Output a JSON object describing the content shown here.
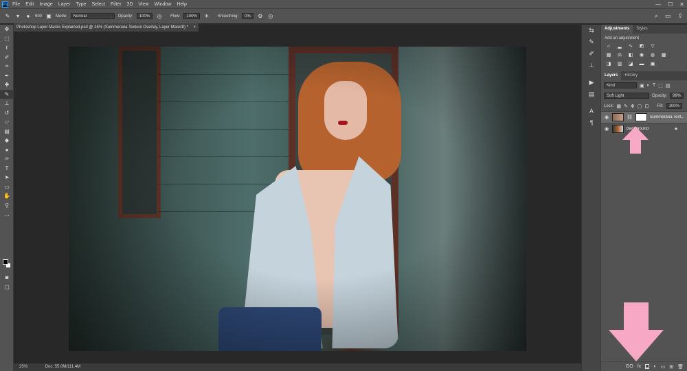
{
  "menubar": {
    "logo": "Ps",
    "items": [
      "File",
      "Edit",
      "Image",
      "Layer",
      "Type",
      "Select",
      "Filter",
      "3D",
      "View",
      "Window",
      "Help"
    ],
    "window_controls": [
      "—",
      "☐",
      "✕"
    ]
  },
  "options": {
    "brush_size": "500",
    "mode_label": "Mode:",
    "mode_value": "Normal",
    "opacity_label": "Opacity:",
    "opacity_value": "100%",
    "flow_label": "Flow:",
    "flow_value": "100%",
    "smoothing_label": "Smoothing:",
    "smoothing_value": "0%"
  },
  "document": {
    "tab_title": "Photoshop Layer Masks Explained.psd @ 25% (Summerana Texture Overlay, Layer Mask/8) *",
    "close": "×"
  },
  "status": {
    "zoom": "25%",
    "doc_info": "Doc: 55.0M/111.4M"
  },
  "adjustments_panel": {
    "tabs": [
      "Adjustments",
      "Styles"
    ],
    "heading": "Add an adjustment"
  },
  "layers_panel": {
    "tabs": [
      "Layers",
      "History"
    ],
    "kind_label": "Kind",
    "blend_mode": "Soft Light",
    "opacity_label": "Opacity:",
    "opacity_value": "99%",
    "lock_label": "Lock:",
    "fill_label": "Fill:",
    "fill_value": "100%",
    "layers": [
      {
        "name": "Summerana Text..."
      },
      {
        "name": "Background"
      }
    ],
    "bottom_icons": [
      "GO",
      "fx"
    ]
  },
  "annotations": {
    "arrow_color": "#f7a8c4"
  }
}
